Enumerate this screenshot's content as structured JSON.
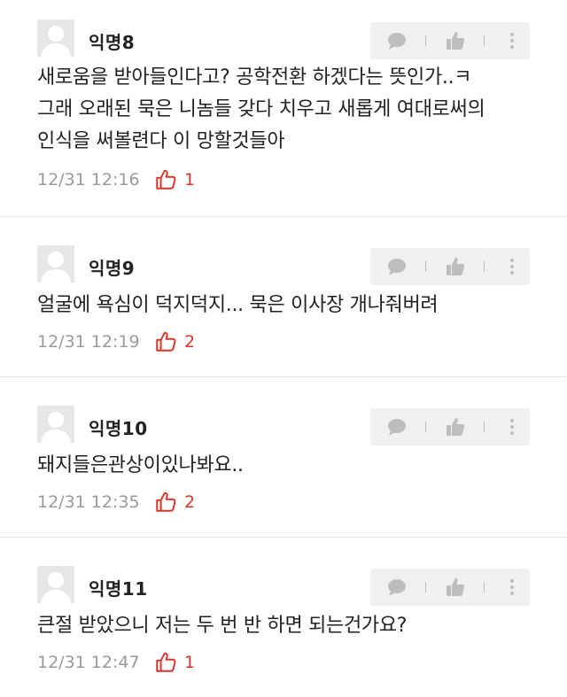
{
  "comments": [
    {
      "user": "익명8",
      "text": "새로움을 받아들인다고? 공학전환 하겠다는 뜻인가..ㅋ\n그래 오래된 묵은 니놈들 갖다 치우고 새롭게 여대로써의\n인식을 써볼련다 이 망할것들아",
      "time": "12/31 12:16",
      "likes": "1"
    },
    {
      "user": "익명9",
      "text": "얼굴에 욕심이 덕지덕지... 묵은 이사장 개나줘버려",
      "time": "12/31 12:19",
      "likes": "2"
    },
    {
      "user": "익명10",
      "text": "돼지들은관상이있나봐요..",
      "time": "12/31 12:35",
      "likes": "2"
    },
    {
      "user": "익명11",
      "text": "큰절 받았으니 저는 두 번 반 하면 되는건가요?",
      "time": "12/31 12:47",
      "likes": "1"
    }
  ],
  "icons": {
    "reply": "speech-bubble-icon",
    "like": "thumbs-up-icon",
    "more": "kebab-menu-icon",
    "like_count": "thumbs-up-outline-icon"
  },
  "colors": {
    "like_accent": "#d9352b",
    "meta_gray": "#9a9a9a",
    "action_bg": "#f0f0f0"
  }
}
